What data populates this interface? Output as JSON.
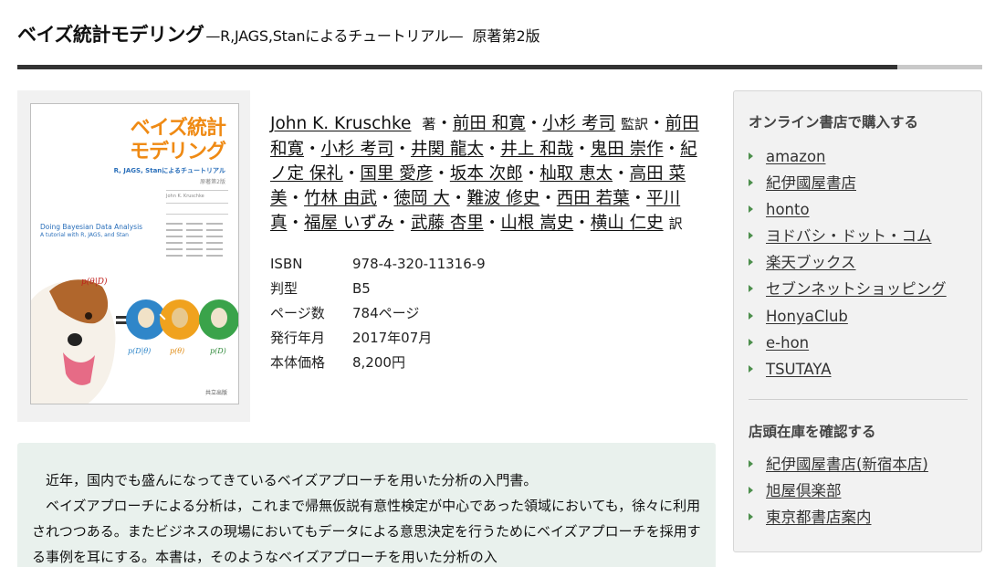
{
  "title": {
    "main": "ベイズ統計モデリング",
    "subtitle": "—R,JAGS,Stanによるチュートリアル—",
    "edition": "原著第2版"
  },
  "cover": {
    "title_line1": "ベイズ統計",
    "title_line2": "モデリング",
    "subtitle": "R, JAGS, Stanによるチュートリアル",
    "edition": "原著第2版",
    "author": "John K. Kruschke",
    "english_title": "Doing Bayesian Data Analysis",
    "english_subtitle": "A tutorial with R, JAGS, and Stan",
    "formula_top": "p(θ|D)",
    "formula_l": "p(D|θ)",
    "formula_m": "p(θ)",
    "formula_r": "p(D)",
    "publisher": "共立出版"
  },
  "authors": {
    "author": "John K. Kruschke",
    "author_role": "著",
    "supervisors": [
      "前田 和寛",
      "小杉 考司"
    ],
    "supervisor_role": "監訳",
    "translators": [
      "前田 和寛",
      "小杉 考司",
      "井関 龍太",
      "井上 和哉",
      "鬼田 崇作",
      "紀ノ定 保礼",
      "国里 愛彦",
      "坂本 次郎",
      "杣取 恵太",
      "高田 菜美",
      "竹林 由武",
      "徳岡 大",
      "難波 修史",
      "西田 若葉",
      "平川 真",
      "福屋 いずみ",
      "武藤 杏里",
      "山根 嵩史",
      "横山 仁史"
    ],
    "translator_role": "訳"
  },
  "specs": [
    {
      "label": "ISBN",
      "value": "978-4-320-11316-9"
    },
    {
      "label": "判型",
      "value": "B5"
    },
    {
      "label": "ページ数",
      "value": "784ページ"
    },
    {
      "label": "発行年月",
      "value": "2017年07月"
    },
    {
      "label": "本体価格",
      "value": "8,200円"
    }
  ],
  "description": {
    "p1": "近年，国内でも盛んになってきているベイズアプローチを用いた分析の入門書。",
    "p2": "ベイズアプローチによる分析は，これまで帰無仮説有意性検定が中心であった領域においても，徐々に利用されつつある。またビジネスの現場においてもデータによる意思決定を行うためにベイズアプローチを採用する事例を耳にする。本書は，そのようなベイズアプローチを用いた分析の入"
  },
  "sidebar": {
    "online_heading": "オンライン書店で購入する",
    "online_stores": [
      "amazon",
      "紀伊國屋書店",
      "honto",
      "ヨドバシ・ドット・コム",
      "楽天ブックス",
      "セブンネットショッピング",
      "HonyaClub",
      "e-hon",
      "TSUTAYA"
    ],
    "stock_heading": "店頭在庫を確認する",
    "stock_stores": [
      "紀伊國屋書店(新宿本店)",
      "旭屋倶楽部",
      "東京都書店案内"
    ]
  },
  "colors": {
    "rule_dark": "#333333",
    "rule_light": "#c9c9c9",
    "description_bg": "#e9f1ed",
    "sidebar_bg": "#f2f2f2",
    "arrow": "#4d8f4d",
    "cover_title": "#ef8a14"
  }
}
